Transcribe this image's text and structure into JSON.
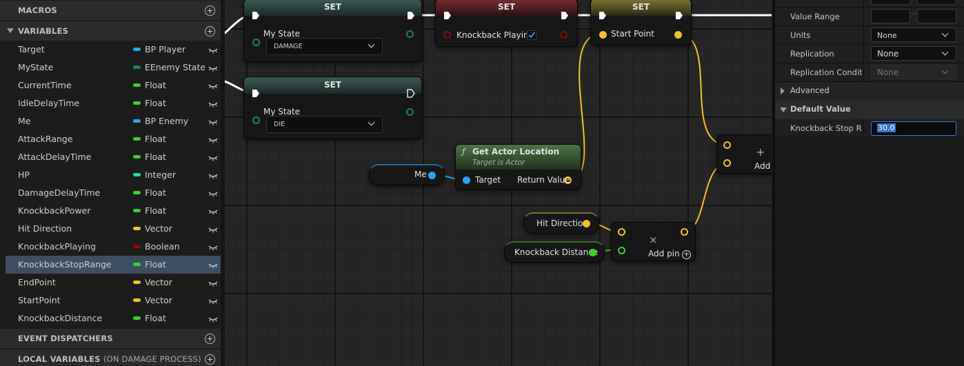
{
  "left_panel": {
    "macros_label": "MACROS",
    "variables_label": "VARIABLES",
    "event_dispatchers_label": "EVENT DISPATCHERS",
    "local_variables_label": "LOCAL VARIABLES",
    "local_variables_sub": "(ON DAMAGE PROCESS)",
    "variables": [
      {
        "name": "Target",
        "type": "BP Player",
        "color": "#2aa6f0"
      },
      {
        "name": "MyState",
        "type": "EEnemy State",
        "color": "#1f7e78"
      },
      {
        "name": "CurrentTime",
        "type": "Float",
        "color": "#3bd22c"
      },
      {
        "name": "IdleDelayTime",
        "type": "Float",
        "color": "#3bd22c"
      },
      {
        "name": "Me",
        "type": "BP Enemy",
        "color": "#2aa6f0"
      },
      {
        "name": "AttackRange",
        "type": "Float",
        "color": "#3bd22c"
      },
      {
        "name": "AttackDelayTime",
        "type": "Float",
        "color": "#3bd22c"
      },
      {
        "name": "HP",
        "type": "Integer",
        "color": "#2dd6a6"
      },
      {
        "name": "DamageDelayTime",
        "type": "Float",
        "color": "#3bd22c"
      },
      {
        "name": "KnockbackPower",
        "type": "Float",
        "color": "#3bd22c"
      },
      {
        "name": "Hit Direction",
        "type": "Vector",
        "color": "#f5c12a"
      },
      {
        "name": "KnockbackPlaying",
        "type": "Boolean",
        "color": "#930606"
      },
      {
        "name": "KnockbackStopRange",
        "type": "Float",
        "color": "#3bd22c",
        "selected": true
      },
      {
        "name": "EndPoint",
        "type": "Vector",
        "color": "#f5c12a"
      },
      {
        "name": "StartPoint",
        "type": "Vector",
        "color": "#f5c12a"
      },
      {
        "name": "KnockbackDistance",
        "type": "Float",
        "color": "#3bd22c"
      }
    ]
  },
  "graph": {
    "set_title": "SET",
    "set1_pin": "My State",
    "set1_value": "DAMAGE",
    "set2_pin": "Knockback Playing",
    "set2_checked": true,
    "set3_pin": "Start Point",
    "set4_pin": "My State",
    "set4_value": "DIE",
    "get_loc_title": "Get Actor Location",
    "get_loc_sub": "Target is Actor",
    "get_loc_target": "Target",
    "get_loc_return": "Return Value",
    "me_node": "Me",
    "hit_dir_node": "Hit Direction",
    "kb_dist_node": "Knockback Distance",
    "multiply_add_pin": "Add pin",
    "add_label": "Add"
  },
  "details": {
    "value_range_label": "Value Range",
    "units_label": "Units",
    "units_value": "None",
    "replication_label": "Replication",
    "replication_value": "None",
    "rep_condition_label": "Replication Condition",
    "rep_condition_value": "None",
    "advanced_label": "Advanced",
    "default_value_label": "Default Value",
    "kb_stop_label": "Knockback Stop Range",
    "kb_stop_value": "30.0"
  },
  "colors": {
    "exec": "#ffffff",
    "vector": "#f5c12a",
    "float": "#3bd22c",
    "object": "#2aa6f0",
    "boolean": "#930606",
    "enum": "#1f7e78"
  }
}
